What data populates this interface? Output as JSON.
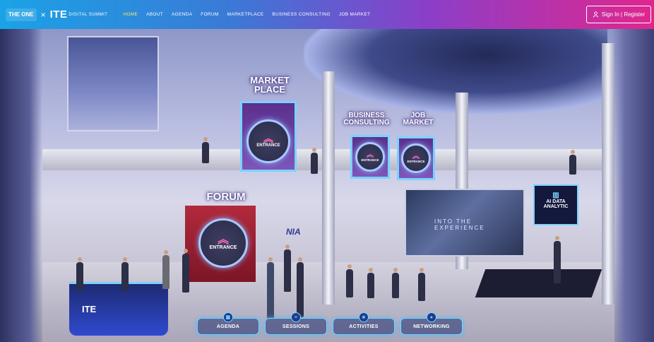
{
  "header": {
    "logo_left": "THE ONE",
    "logo_separator": "×",
    "logo_ite": "ITE",
    "logo_ite_sub": "DIGITAL SUMMIT",
    "nav": [
      {
        "label": "HOME",
        "active": true
      },
      {
        "label": "ABOUT",
        "active": false
      },
      {
        "label": "AGENDA",
        "active": false
      },
      {
        "label": "FORUM",
        "active": false
      },
      {
        "label": "MARKETPLACE",
        "active": false
      },
      {
        "label": "BUSINESS CONSULTING",
        "active": false
      },
      {
        "label": "JOB MARKET",
        "active": false
      }
    ],
    "signin_label": "Sign In | Register",
    "signin_icon": "user-icon"
  },
  "scene": {
    "marketplace": {
      "title_line1": "MARKET",
      "title_line2": "PLACE",
      "entrance": "ENTRANCE"
    },
    "business_consulting": {
      "title_line1": "BUSINESS",
      "title_line2": "CONSULTING",
      "entrance": "ENTRANCE"
    },
    "job_market": {
      "title_line1": "JOB",
      "title_line2": "MARKET",
      "entrance": "ENTRANCE"
    },
    "forum": {
      "title": "FORUM",
      "entrance": "ENTRANCE"
    },
    "screen_text": "INTO THE EXPERIENCE",
    "ai_panel": {
      "line1": "AI DATA",
      "line2": "ANALYTIC"
    },
    "desk_text": "ITE",
    "booth_logo": "NIA"
  },
  "quick_links": [
    {
      "label": "AGENDA",
      "icon": "calendar-icon"
    },
    {
      "label": "SESSIONS",
      "icon": "list-icon"
    },
    {
      "label": "ACTIVITIES",
      "icon": "star-icon"
    },
    {
      "label": "NETWORKING",
      "icon": "chat-icon"
    }
  ],
  "colors": {
    "bar_start": "#1aa3e6",
    "bar_end": "#e0268e",
    "active_nav": "#ffe96b",
    "glow": "#7ad2ff"
  }
}
